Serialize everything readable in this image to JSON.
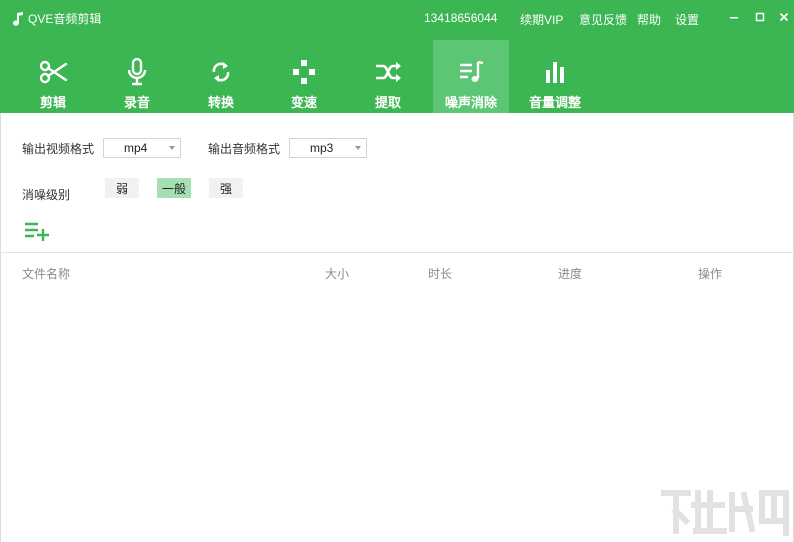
{
  "app": {
    "title": "QVE音频剪辑"
  },
  "topbar": {
    "phone": "13418656044",
    "renew_vip": "续期VIP",
    "feedback": "意见反馈",
    "help": "帮助",
    "settings": "设置"
  },
  "nav": {
    "items": [
      {
        "label": "剪辑",
        "icon": "scissors-icon"
      },
      {
        "label": "录音",
        "icon": "microphone-icon"
      },
      {
        "label": "转换",
        "icon": "refresh-icon"
      },
      {
        "label": "变速",
        "icon": "dpad-icon"
      },
      {
        "label": "提取",
        "icon": "shuffle-icon"
      },
      {
        "label": "噪声消除",
        "icon": "playlist-note-icon",
        "active": true
      },
      {
        "label": "音量调整",
        "icon": "bar-chart-icon"
      }
    ]
  },
  "settings": {
    "video_format_label": "输出视频格式",
    "video_format_value": "mp4",
    "audio_format_label": "输出音频格式",
    "audio_format_value": "mp3",
    "noise_level_label": "消噪级别",
    "levels": [
      "弱",
      "一般",
      "强"
    ],
    "selected_level": "一般"
  },
  "table": {
    "headers": [
      "文件名称",
      "大小",
      "时长",
      "进度",
      "操作"
    ]
  },
  "colors": {
    "brand": "#3cb553",
    "active_tab": "#5dc674",
    "active_level": "#a6dfb1"
  }
}
